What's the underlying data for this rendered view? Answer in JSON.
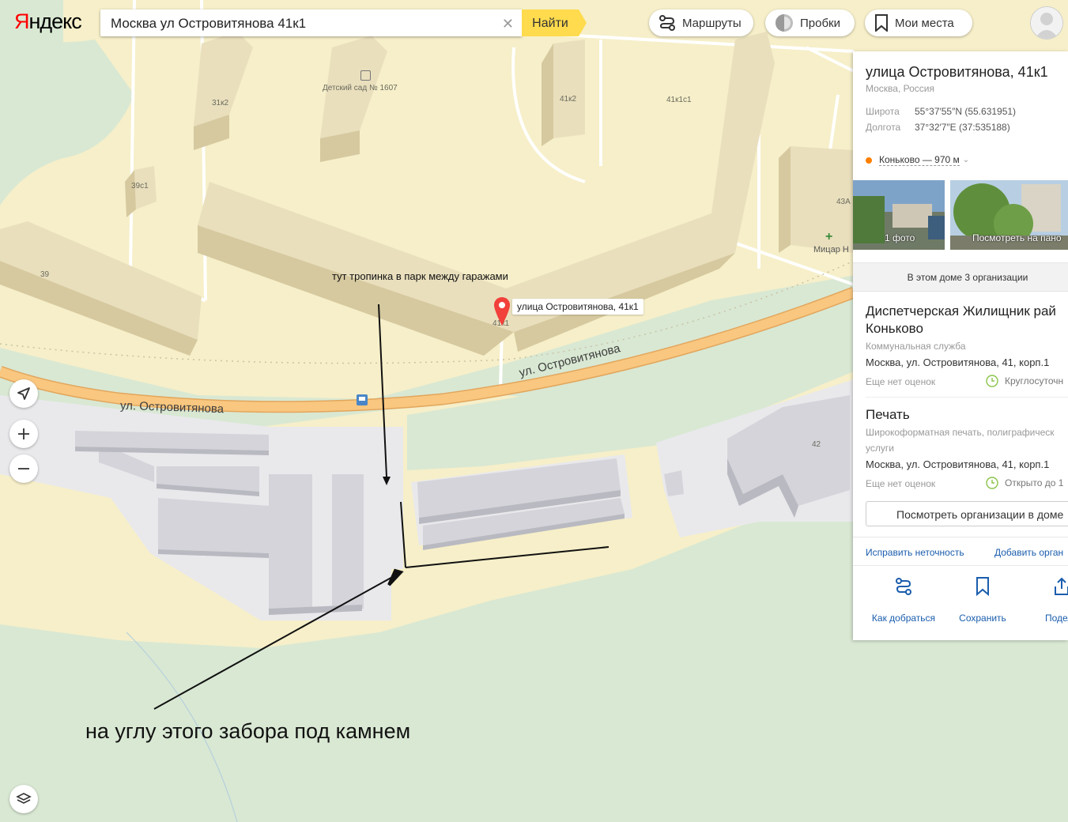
{
  "brand": {
    "logo_first": "Я",
    "logo_rest": "ндекс"
  },
  "search": {
    "value": "Москва ул Островитянова 41к1",
    "find_label": "Найти"
  },
  "toolbar": {
    "routes": "Маршруты",
    "traffic": "Пробки",
    "places": "Мои места"
  },
  "map": {
    "street_left": "ул. Островитянова",
    "street_right": "ул. Островитянова",
    "kindergarten": "Детский сад № 1607",
    "buildings": [
      "31к2",
      "41к2",
      "41к1с1",
      "39с1",
      "39",
      "43А",
      "42",
      "41к1"
    ],
    "poi_mitsar": "Мицар Н",
    "marker_label": "улица Островитянова, 41к1",
    "note_path": "тут тропинка в парк между гаражами",
    "note_corner": "на углу этого забора под камнем",
    "colors": {
      "land": "#f6efc9",
      "park": "#d9e8d3",
      "road": "#f9c77f",
      "garage": "#e4e4e7",
      "building": "#e9dfbd"
    }
  },
  "panel": {
    "title": "улица Островитянова, 41к1",
    "subtitle": "Москва, Россия",
    "lat_label": "Широта",
    "lat_value": "55°37′55″N (55.631951)",
    "lon_label": "Долгота",
    "lon_value": "37°32′7″E (37:535188)",
    "metro": "Коньково — 970 м",
    "photo_label": "1 фото",
    "pano_label": "Посмотреть на пано",
    "orgs_count": "В этом доме 3 организации",
    "orgs": [
      {
        "name_1": "Диспетчерская Жилищник рай",
        "name_2": "Коньково",
        "category": "Коммунальная служба",
        "address": "Москва, ул. Островитянова, 41, корп.1",
        "rating": "Еще нет оценок",
        "hours": "Круглосуточн"
      },
      {
        "name_1": "Печать",
        "category_1": "Широкоформатная печать, полиграфическ",
        "category_2": "услуги",
        "address": "Москва, ул. Островитянова, 41, корп.1",
        "rating": "Еще нет оценок",
        "hours": "Открыто до 1"
      }
    ],
    "view_orgs": "Посмотреть организации в доме",
    "fix_link": "Исправить неточность",
    "add_link": "Добавить орган",
    "act_route": "Как добраться",
    "act_save": "Сохранить",
    "act_share": "Подели"
  }
}
